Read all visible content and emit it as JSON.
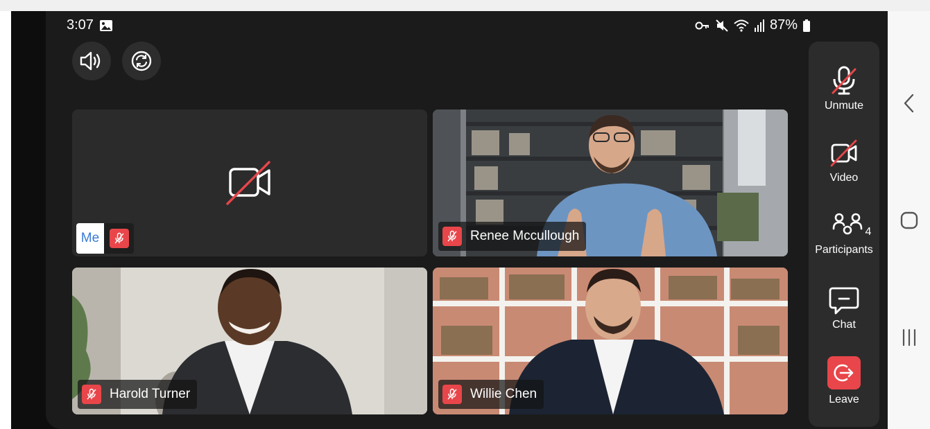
{
  "status_bar": {
    "time": "3:07",
    "battery": "87%"
  },
  "top_controls": {
    "speaker_icon": "speaker-icon",
    "switch_camera_icon": "switch-camera-icon"
  },
  "tiles": [
    {
      "id": "me",
      "label": "Me",
      "camera": "off",
      "mic": "muted"
    },
    {
      "id": "renee",
      "name": "Renee Mccullough",
      "mic": "muted"
    },
    {
      "id": "harold",
      "name": "Harold Turner",
      "mic": "muted"
    },
    {
      "id": "willie",
      "name": "Willie Chen",
      "mic": "muted"
    }
  ],
  "side_controls": {
    "unmute_label": "Unmute",
    "video_label": "Video",
    "participants_label": "Participants",
    "participants_count": "4",
    "chat_label": "Chat",
    "leave_label": "Leave"
  },
  "colors": {
    "screen_bg": "#1b1b1b",
    "panel_bg": "#2c2c2c",
    "danger": "#e8464a",
    "me_text": "#3a7bd5"
  }
}
